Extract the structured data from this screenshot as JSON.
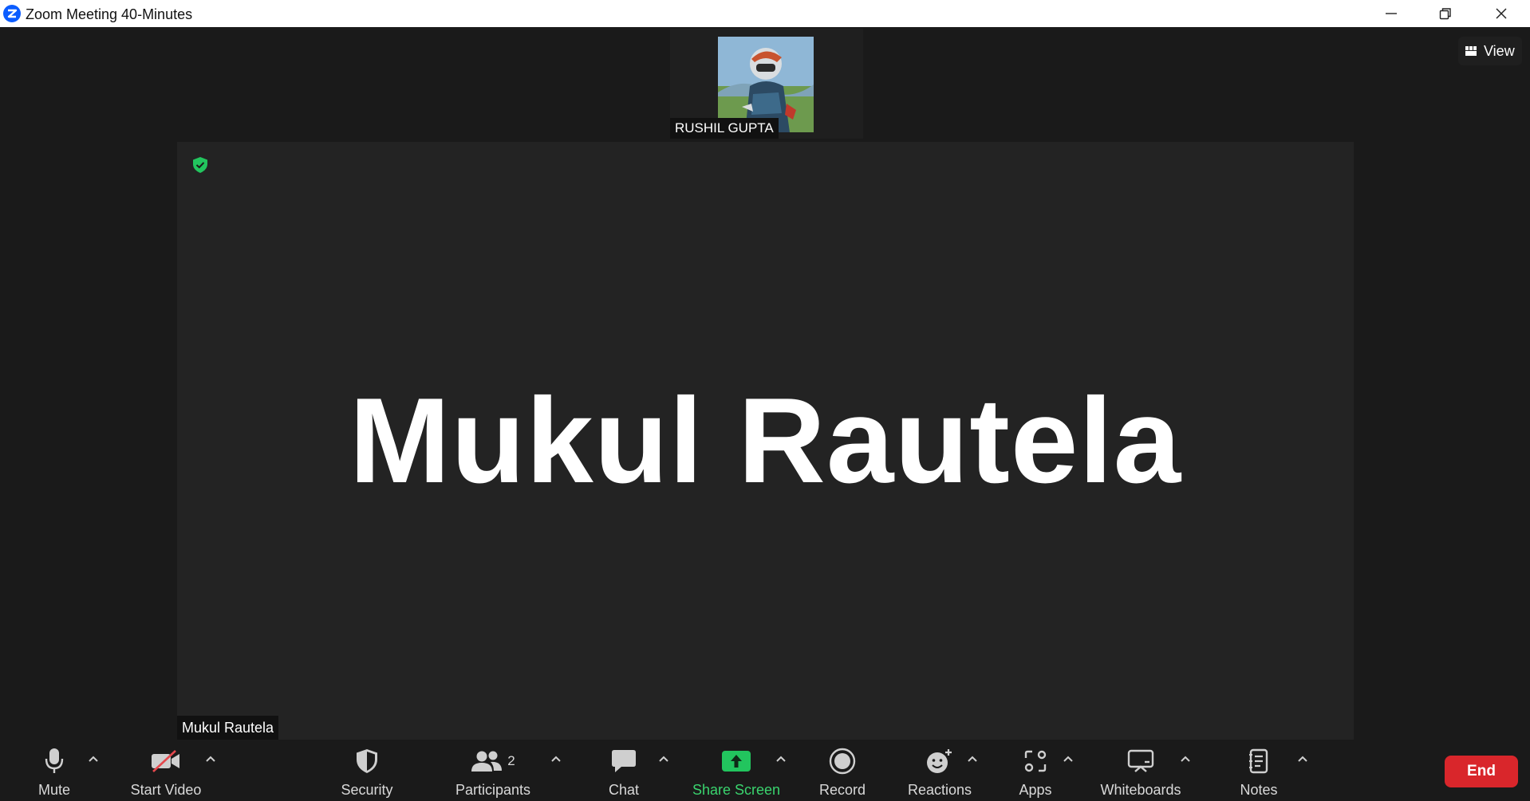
{
  "window": {
    "title": "Zoom Meeting 40-Minutes"
  },
  "thumbnail": {
    "participant_name": "RUSHIL GUPTA"
  },
  "view_button": {
    "label": "View"
  },
  "main_tile": {
    "speaker_name_large": "Mukul Rautela",
    "speaker_label": "Mukul Rautela"
  },
  "toolbar": {
    "mute": "Mute",
    "start_video": "Start Video",
    "security": "Security",
    "participants": "Participants",
    "participants_count": "2",
    "chat": "Chat",
    "share_screen": "Share Screen",
    "record": "Record",
    "reactions": "Reactions",
    "apps": "Apps",
    "whiteboards": "Whiteboards",
    "notes": "Notes",
    "end": "End"
  },
  "colors": {
    "accent_blue": "#0b5cff",
    "share_green": "#22c55e",
    "end_red": "#d9262b",
    "encryption_green": "#22c55e"
  }
}
